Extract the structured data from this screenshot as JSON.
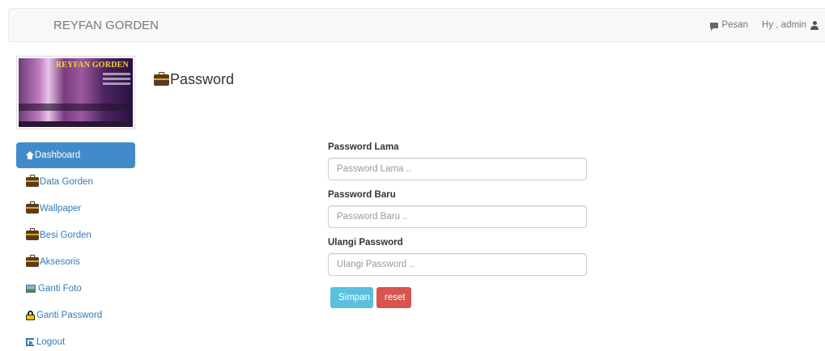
{
  "navbar": {
    "brand": "REYFAN GORDEN",
    "messages_label": "Pesan",
    "user_label": "Hy , admin"
  },
  "logo": {
    "text": "REYFAN GORDEN"
  },
  "page": {
    "title": "Password"
  },
  "sidebar": {
    "items": [
      {
        "label": "Dashboard",
        "icon": "home-icon",
        "active": true
      },
      {
        "label": "Data Gorden",
        "icon": "briefcase-icon"
      },
      {
        "label": "Wallpaper",
        "icon": "briefcase-icon"
      },
      {
        "label": "Besi Gorden",
        "icon": "briefcase-icon"
      },
      {
        "label": "Aksesoris",
        "icon": "briefcase-icon"
      },
      {
        "label": "Ganti Foto",
        "icon": "picture-icon"
      },
      {
        "label": "Ganti Password",
        "icon": "lock-icon"
      },
      {
        "label": "Logout",
        "icon": "logout-icon"
      }
    ]
  },
  "form": {
    "old_password": {
      "label": "Password Lama",
      "placeholder": "Password Lama .."
    },
    "new_password": {
      "label": "Password Baru",
      "placeholder": "Password Baru .."
    },
    "repeat_password": {
      "label": "Ulangi Password",
      "placeholder": "Ulangi Password .."
    },
    "submit_label": "Simpan",
    "reset_label": "reset"
  },
  "colors": {
    "primary": "#428bca",
    "link": "#337ab7",
    "info": "#5bc0de",
    "danger": "#d9534f"
  }
}
